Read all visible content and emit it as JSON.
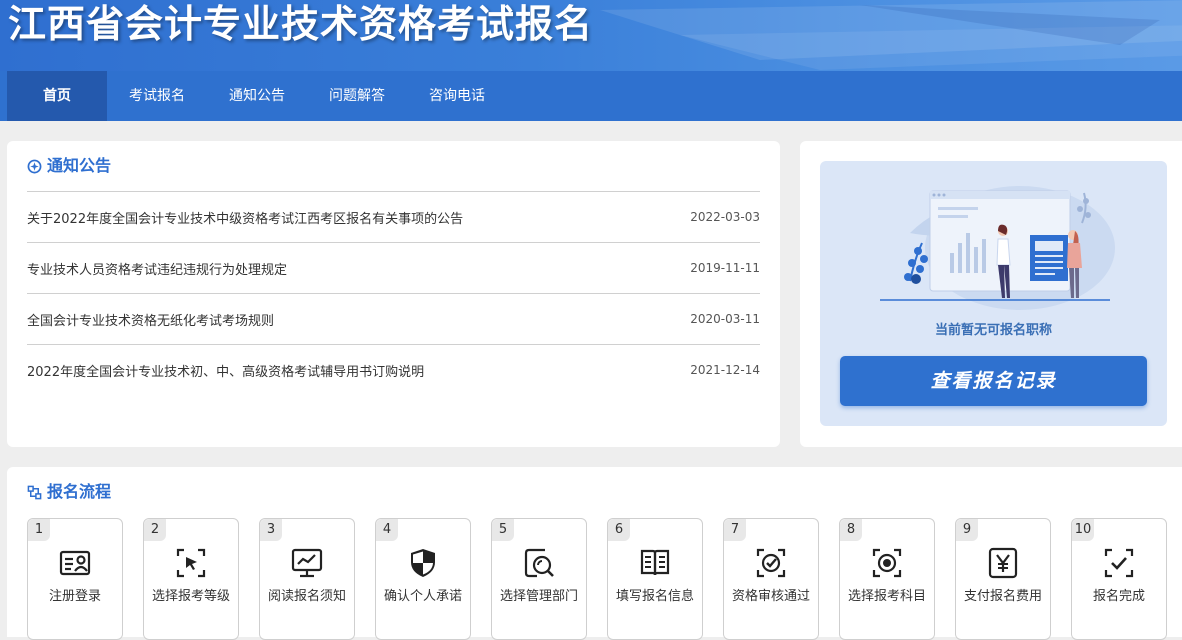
{
  "header": {
    "title": "江西省会计专业技术资格考试报名"
  },
  "nav": {
    "items": [
      {
        "label": "首页"
      },
      {
        "label": "考试报名"
      },
      {
        "label": "通知公告"
      },
      {
        "label": "问题解答"
      },
      {
        "label": "咨询电话"
      }
    ]
  },
  "notice": {
    "title": "通知公告",
    "items": [
      {
        "title": "关于2022年度全国会计专业技术中级资格考试江西考区报名有关事项的公告",
        "date": "2022-03-03"
      },
      {
        "title": "专业技术人员资格考试违纪违规行为处理规定",
        "date": "2019-11-11"
      },
      {
        "title": "全国会计专业技术资格无纸化考试考场规则",
        "date": "2020-03-11"
      },
      {
        "title": "2022年度全国会计专业技术初、中、高级资格考试辅导用书订购说明",
        "date": "2021-12-14"
      }
    ]
  },
  "side": {
    "message": "当前暂无可报名职称",
    "button": "查看报名记录"
  },
  "flow": {
    "title": "报名流程",
    "steps": [
      {
        "num": "1",
        "label": "注册登录",
        "icon": "id-card-icon"
      },
      {
        "num": "2",
        "label": "选择报考等级",
        "icon": "cursor-select-icon"
      },
      {
        "num": "3",
        "label": "阅读报名须知",
        "icon": "monitor-chart-icon"
      },
      {
        "num": "4",
        "label": "确认个人承诺",
        "icon": "shield-icon"
      },
      {
        "num": "5",
        "label": "选择管理部门",
        "icon": "search-doc-icon"
      },
      {
        "num": "6",
        "label": "填写报名信息",
        "icon": "book-icon"
      },
      {
        "num": "7",
        "label": "资格审核通过",
        "icon": "check-circle-icon"
      },
      {
        "num": "8",
        "label": "选择报考科目",
        "icon": "target-icon"
      },
      {
        "num": "9",
        "label": "支付报名费用",
        "icon": "yen-icon"
      },
      {
        "num": "10",
        "label": "报名完成",
        "icon": "check-frame-icon"
      }
    ]
  },
  "colors": {
    "primary": "#2f71cf",
    "nav_active": "#2459ad",
    "panel_bg": "#dbe6f7"
  }
}
